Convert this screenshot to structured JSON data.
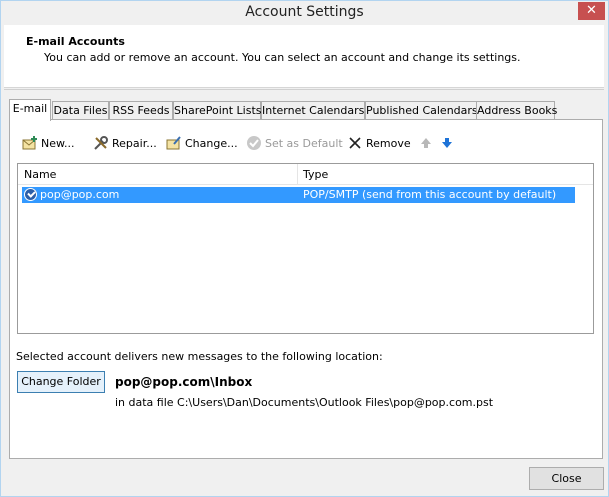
{
  "window": {
    "title": "Account Settings",
    "close_glyph": "✕"
  },
  "header": {
    "title": "E-mail Accounts",
    "subtitle": "You can add or remove an account. You can select an account and change its settings."
  },
  "tabs": [
    {
      "label": "E-mail",
      "active": true
    },
    {
      "label": "Data Files"
    },
    {
      "label": "RSS Feeds"
    },
    {
      "label": "SharePoint Lists"
    },
    {
      "label": "Internet Calendars"
    },
    {
      "label": "Published Calendars"
    },
    {
      "label": "Address Books"
    }
  ],
  "toolbar": {
    "new_label": "New...",
    "repair_label": "Repair...",
    "change_label": "Change...",
    "default_label": "Set as Default",
    "remove_label": "Remove",
    "new_icon": "new-account-icon",
    "repair_icon": "repair-tools-icon",
    "change_icon": "change-settings-icon",
    "default_icon": "check-circle-icon",
    "remove_icon": "x-remove-icon",
    "move_up_icon": "arrow-up-icon",
    "move_down_icon": "arrow-down-icon"
  },
  "list": {
    "columns": [
      "Name",
      "Type"
    ],
    "rows": [
      {
        "name": "pop@pop.com",
        "type": "POP/SMTP (send from this account by default)",
        "selected": true
      }
    ]
  },
  "delivery": {
    "label": "Selected account delivers new messages to the following location:",
    "change_folder_label": "Change Folder",
    "folder_path": "pop@pop.com\\Inbox",
    "data_file": "in data file C:\\Users\\Dan\\Documents\\Outlook Files\\pop@pop.com.pst"
  },
  "footer": {
    "close_label": "Close"
  },
  "colors": {
    "selection": "#3399ff",
    "window_bg": "#f0f0f0",
    "close_button": "#c75050",
    "arrow_blue": "#1e73d7"
  }
}
